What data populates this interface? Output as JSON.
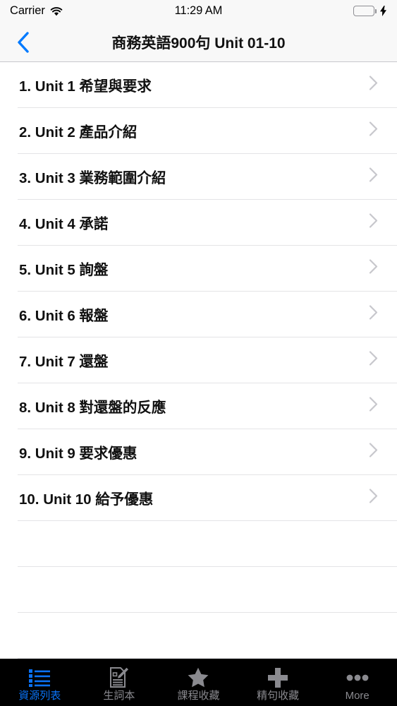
{
  "status_bar": {
    "carrier": "Carrier",
    "wifi_icon": "wifi-icon",
    "time": "11:29 AM",
    "battery_icon": "battery-icon",
    "charging_icon": "lightning-bolt-icon",
    "battery_color": "#4cd964"
  },
  "nav_bar": {
    "back_icon": "chevron-left-icon",
    "back_color": "#007aff",
    "title": "商務英語900句 Unit 01-10",
    "background": "#f8f8f8"
  },
  "list": {
    "chevron_icon": "chevron-right-icon",
    "separator_color": "#e4e4e6",
    "items": [
      {
        "label": "1. Unit 1 希望與要求"
      },
      {
        "label": "2. Unit 2 產品介紹"
      },
      {
        "label": "3. Unit 3 業務範圍介紹"
      },
      {
        "label": "4. Unit 4 承諾"
      },
      {
        "label": "5. Unit 5 詢盤"
      },
      {
        "label": "6. Unit 6 報盤"
      },
      {
        "label": "7. Unit 7 還盤"
      },
      {
        "label": "8. Unit 8 對還盤的反應"
      },
      {
        "label": "9. Unit 9 要求優惠"
      },
      {
        "label": "10. Unit 10 給予優惠"
      }
    ],
    "empty_rows": 3
  },
  "tab_bar": {
    "background": "#000000",
    "active_color": "#0a72f5",
    "inactive_color": "#8a8a8f",
    "tabs": [
      {
        "label": "資源列表",
        "icon": "list-icon",
        "active": true
      },
      {
        "label": "生詞本",
        "icon": "note-pencil-icon",
        "active": false
      },
      {
        "label": "課程收藏",
        "icon": "star-icon",
        "active": false
      },
      {
        "label": "精句收藏",
        "icon": "plus-icon",
        "active": false
      },
      {
        "label": "More",
        "icon": "ellipsis-icon",
        "active": false
      }
    ]
  }
}
